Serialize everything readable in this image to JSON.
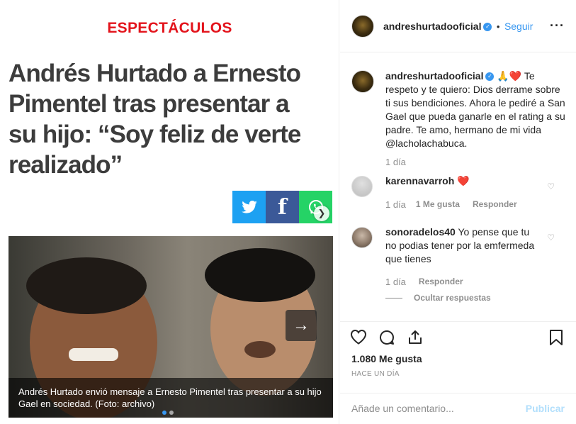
{
  "post": {
    "section": "ESPECTÁCULOS",
    "headline": "Andrés Hurtado a Ernesto Pimentel tras presentar a su hijo: “Soy feliz de verte realizado”",
    "share": {
      "twitter": "twitter",
      "facebook": "f",
      "whatsapp": "whatsapp"
    },
    "photo_caption": "Andrés Hurtado envió mensaje a Ernesto Pimentel tras presentar a su hijo Gael en sociedad. (Foto: archivo)"
  },
  "header": {
    "username": "andreshurtadooficial",
    "separator": "•",
    "follow_label": "Seguir",
    "more_label": "···"
  },
  "caption": {
    "username": "andreshurtadooficial",
    "emoji": "🙏❤️",
    "text": "Te respeto y te quiero: Dios derrame sobre ti sus bendiciones. Ahora le pediré a San Gael que pueda ganarle en el rating a su padre. Te amo, hermano de mi vida @lacholachabuca.",
    "time": "1 día"
  },
  "comments": [
    {
      "username": "karennavarroh",
      "text": "❤️",
      "time": "1 día",
      "likes": "1 Me gusta",
      "reply": "Responder"
    },
    {
      "username": "sonoradelos40",
      "text": "Yo pense que tu no podias tener por la emfermeda que tienes",
      "time": "1 día",
      "reply": "Responder",
      "hide_replies": "Ocultar respuestas"
    }
  ],
  "footer": {
    "likes": "1.080 Me gusta",
    "time": "HACE UN DÍA",
    "comment_placeholder": "Añade un comentario...",
    "publish": "Publicar"
  },
  "colors": {
    "accent": "#3897f0",
    "section_red": "#e3141c",
    "heart": "#ed4956"
  }
}
